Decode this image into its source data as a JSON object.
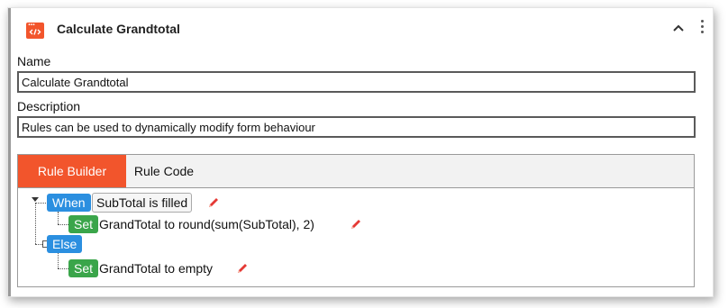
{
  "header": {
    "title": "Calculate Grandtotal",
    "icon": "code-window-icon",
    "accent_color": "#f2552c"
  },
  "name_field": {
    "label": "Name",
    "value": "Calculate Grandtotal"
  },
  "description_field": {
    "label": "Description",
    "value": "Rules can be used to dynamically modify form behaviour"
  },
  "tabs": [
    {
      "label": "Rule Builder",
      "active": true
    },
    {
      "label": "Rule Code",
      "active": false
    }
  ],
  "rule": {
    "when": {
      "keyword": "When",
      "condition": "SubTotal is filled",
      "action": {
        "keyword": "Set",
        "text": "GrandTotal to round(sum(SubTotal), 2)"
      }
    },
    "else": {
      "keyword": "Else",
      "action": {
        "keyword": "Set",
        "text": "GrandTotal to empty"
      }
    }
  },
  "colors": {
    "when_badge": "#2b8fe0",
    "set_badge": "#3aa54a",
    "tab_active": "#f2552c",
    "edit_pencil": "#e53935"
  }
}
